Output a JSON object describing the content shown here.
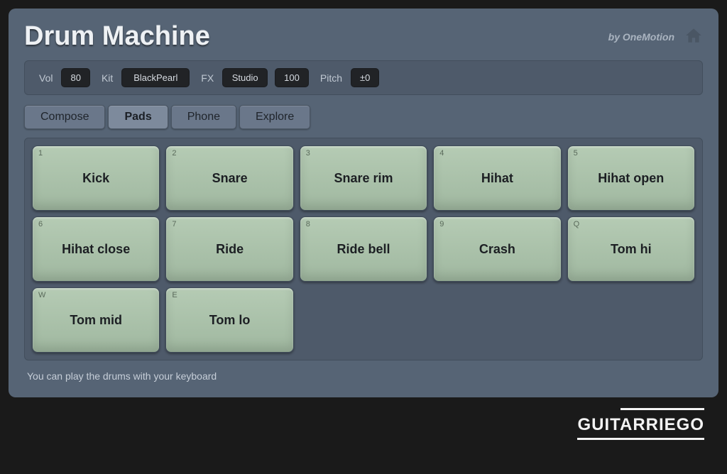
{
  "header": {
    "title": "Drum Machine",
    "byline": "by OneMotion"
  },
  "toolbar": {
    "vol_label": "Vol",
    "vol_value": "80",
    "kit_label": "Kit",
    "kit_value": "BlackPearl",
    "fx_label": "FX",
    "fx_value": "Studio",
    "fx_amount": "100",
    "pitch_label": "Pitch",
    "pitch_value": "±0"
  },
  "tabs": {
    "compose": "Compose",
    "pads": "Pads",
    "phone": "Phone",
    "explore": "Explore",
    "active": "pads"
  },
  "pads": [
    {
      "key": "1",
      "name": "Kick"
    },
    {
      "key": "2",
      "name": "Snare"
    },
    {
      "key": "3",
      "name": "Snare rim"
    },
    {
      "key": "4",
      "name": "Hihat"
    },
    {
      "key": "5",
      "name": "Hihat open"
    },
    {
      "key": "6",
      "name": "Hihat close"
    },
    {
      "key": "7",
      "name": "Ride"
    },
    {
      "key": "8",
      "name": "Ride bell"
    },
    {
      "key": "9",
      "name": "Crash"
    },
    {
      "key": "Q",
      "name": "Tom hi"
    },
    {
      "key": "W",
      "name": "Tom mid"
    },
    {
      "key": "E",
      "name": "Tom lo"
    }
  ],
  "hint": "You can play the drums with your keyboard",
  "watermark": "GUITARRIEGO"
}
